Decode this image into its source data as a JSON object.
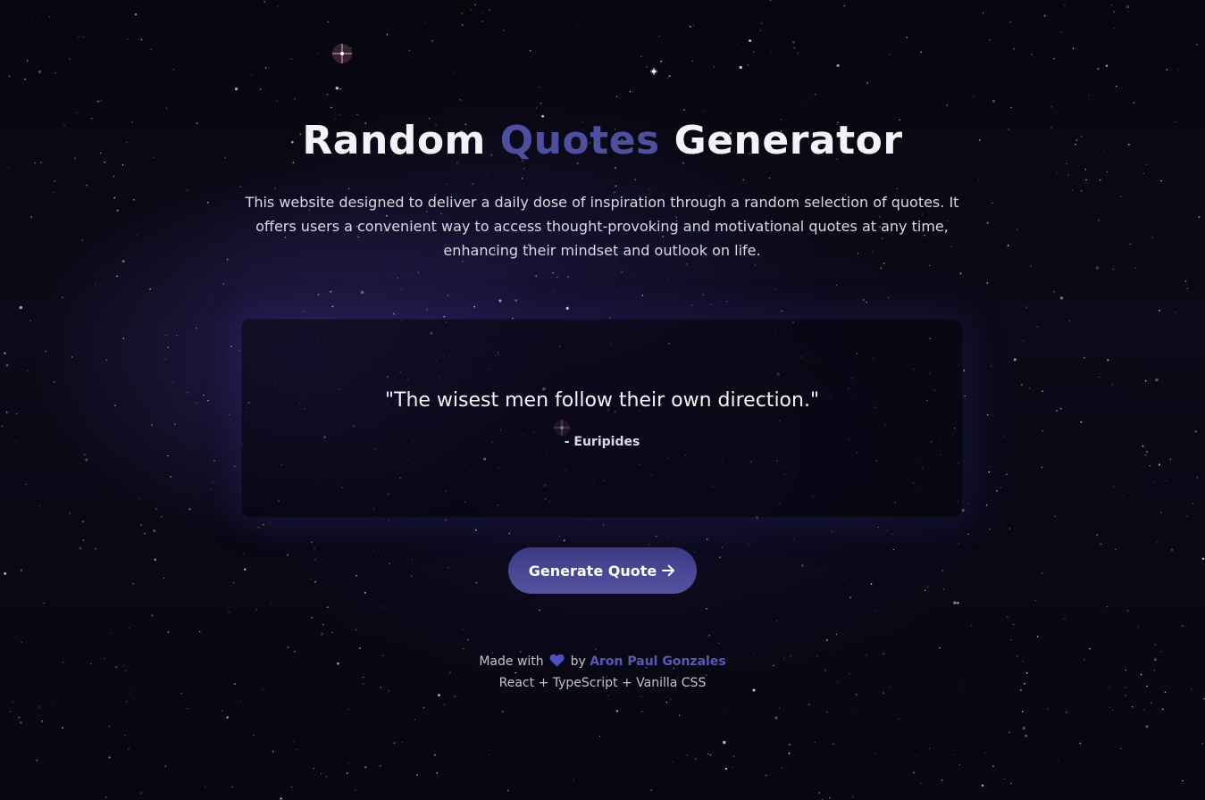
{
  "header": {
    "title_part1": "Random",
    "title_accent": "Quotes",
    "title_part2": "Generator",
    "description": "This website designed to deliver a daily dose of inspiration through a random selection of quotes. It offers users a convenient way to access thought-provoking and motivational quotes at any time, enhancing their mindset and outlook on life."
  },
  "quote": {
    "text": "\"The wisest men follow their own direction.\"",
    "author": "- Euripides"
  },
  "button": {
    "label": "Generate Quote",
    "icon": "arrow-right-icon"
  },
  "footer": {
    "made_with": "Made with",
    "heart_icon": "heart-icon",
    "by": "by",
    "author_name": "Aron Paul Gonzales",
    "stack": "React + TypeScript + Vanilla CSS"
  },
  "colors": {
    "accent": "#4f4fa0",
    "button_top": "#3c3a85",
    "button_bottom": "#55529f",
    "heart": "#4f4fc0",
    "link": "#5a58b0",
    "background": "#07060f"
  }
}
